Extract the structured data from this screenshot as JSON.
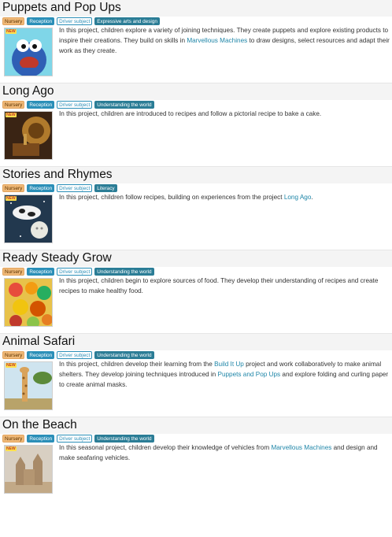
{
  "tags": {
    "nursery": "Nursery",
    "reception": "Reception",
    "driver": "Driver subject"
  },
  "new_badge": "NEW",
  "projects": [
    {
      "title": "Puppets and Pop Ups",
      "subject": "Expressive arts and design",
      "desc_1": "In this project, children explore a variety of joining techniques. They create puppets and explore existing products to inspire their creations. They build on skills in ",
      "link_1": "Marvellous Machines",
      "desc_2": " to draw designs, select resources and adapt their work as they create.",
      "image": "puppet-thumbnail"
    },
    {
      "title": "Long Ago",
      "subject": "Understanding the world",
      "desc_1": "In this project, children are introduced to recipes and follow a pictorial recipe to bake a cake.",
      "image": "gramophone-thumbnail"
    },
    {
      "title": "Stories and Rhymes",
      "subject": "Literacy",
      "desc_1": "In this project, children follow recipes, building on experiences from the project ",
      "link_1": "Long Ago",
      "desc_2": ".",
      "image": "cow-moon-thumbnail"
    },
    {
      "title": "Ready Steady Grow",
      "subject": "Understanding the world",
      "desc_1": "In this project, children begin to explore sources of food. They develop their understanding of recipes and create recipes to make healthy food.",
      "image": "fruit-thumbnail"
    },
    {
      "title": "Animal Safari",
      "subject": "Understanding the world",
      "desc_1": "In this project, children develop their learning from the ",
      "link_1": "Build It Up",
      "desc_2": " project and work collaboratively to make animal shelters. They develop joining techniques introduced in ",
      "link_2": "Puppets and Pop Ups",
      "desc_3": " and explore folding and curling paper to create animal masks.",
      "image": "giraffe-thumbnail"
    },
    {
      "title": "On the Beach",
      "subject": "Understanding the world",
      "desc_1": "In this seasonal project, children develop their knowledge of vehicles from ",
      "link_1": "Marvellous Machines",
      "desc_2": " and design and make seafaring vehicles.",
      "image": "sandcastle-thumbnail"
    }
  ]
}
